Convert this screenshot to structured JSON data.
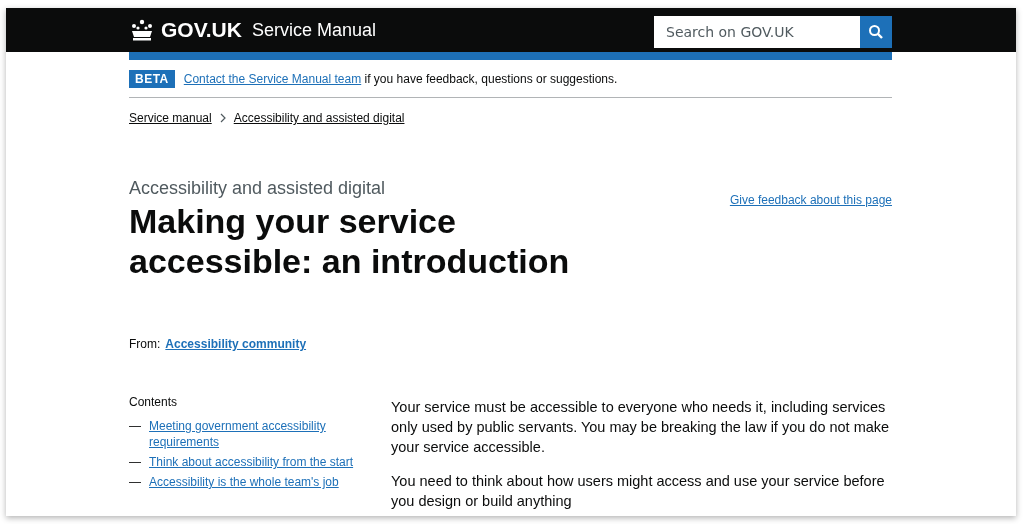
{
  "header": {
    "logo": "GOV.UK",
    "service": "Service Manual",
    "search": {
      "placeholder": "Search on GOV.UK"
    }
  },
  "phase_banner": {
    "tag": "BETA",
    "link": "Contact the Service Manual team",
    "text": "if you have feedback, questions or suggestions."
  },
  "breadcrumbs": [
    "Service manual",
    "Accessibility and assisted digital"
  ],
  "caption": "Accessibility and assisted digital",
  "title": "Making your service accessible: an introduction",
  "feedback_link": "Give feedback about this page",
  "from": {
    "label": "From:",
    "link": "Accessibility community"
  },
  "contents": {
    "heading": "Contents",
    "items": [
      {
        "dash": "—",
        "label": "Meeting government accessibility requirements"
      },
      {
        "dash": "—",
        "label": "Think about accessibility from the start"
      },
      {
        "dash": "—",
        "label": "Accessibility is the whole team's job"
      }
    ]
  },
  "body": [
    "Your service must be accessible to everyone who needs it, including services only used by public servants. You may be breaking the law if you do not make your service accessible.",
    "You need to think about how users might access and use your service before you design or build anything"
  ]
}
